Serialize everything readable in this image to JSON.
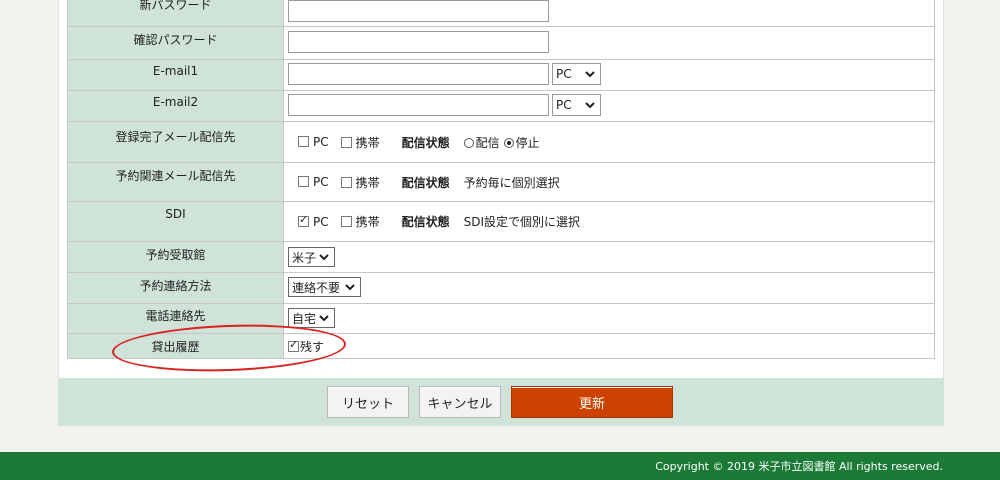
{
  "form": {
    "rows": [
      {
        "label": "新パスワード"
      },
      {
        "label": "確認パスワード"
      },
      {
        "label": "E-mail1",
        "select": "PC"
      },
      {
        "label": "E-mail2",
        "select": "PC"
      },
      {
        "label": "登録完了メール配信先",
        "pc": "PC",
        "mobile": "携帯",
        "status_label": "配信状態",
        "radio_deliver": "配信",
        "radio_stop": "停止"
      },
      {
        "label": "予約関連メール配信先",
        "pc": "PC",
        "mobile": "携帯",
        "status_label": "配信状態",
        "status_text": "予約毎に個別選択"
      },
      {
        "label": "SDI",
        "pc": "PC",
        "mobile": "携帯",
        "status_label": "配信状態",
        "status_text": "SDI設定で個別に選択"
      },
      {
        "label": "予約受取館",
        "select": "米子"
      },
      {
        "label": "予約連絡方法",
        "select": "連絡不要"
      },
      {
        "label": "電話連絡先",
        "select": "自宅"
      },
      {
        "label": "貸出履歴",
        "checkbox_label": "残す"
      }
    ]
  },
  "buttons": {
    "reset": "リセット",
    "cancel": "キャンセル",
    "update": "更新"
  },
  "footer": {
    "copyright": "Copyright © 2019 米子市立図書館 All rights reserved."
  },
  "colors": {
    "label_bg": "#cfe3d8",
    "primary_button": "#cc4200",
    "footer_bg": "#1b7a36",
    "annotation": "#d9211f"
  }
}
